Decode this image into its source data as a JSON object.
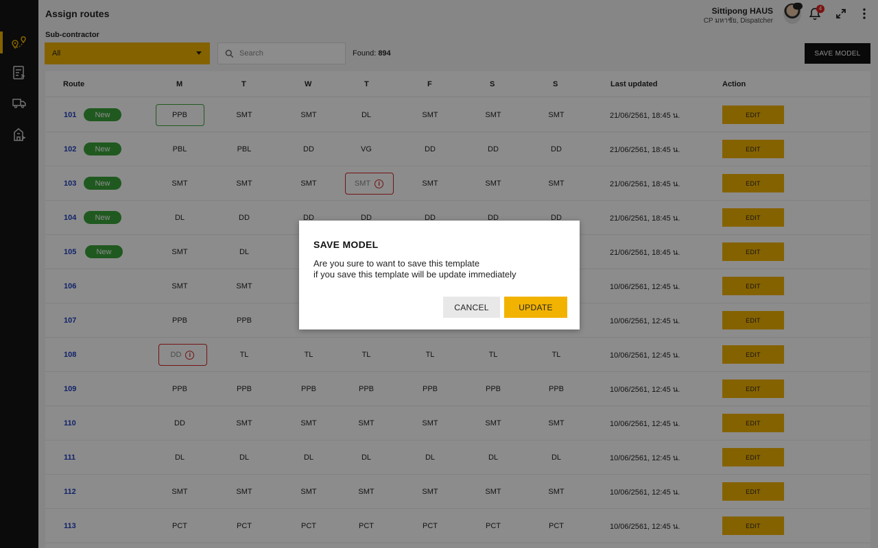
{
  "header": {
    "title": "Assign routes",
    "user_name": "Sittipong HAUS",
    "user_role": "CP มหาชัย, Dispatcher",
    "avatar_badge": "",
    "notification_count": "4"
  },
  "sidebar": {
    "items": [
      {
        "icon": "route-map-icon",
        "active": true
      },
      {
        "icon": "route-list-icon",
        "active": false
      },
      {
        "icon": "truck-icon",
        "active": false
      },
      {
        "icon": "warehouse-icon",
        "active": false
      }
    ]
  },
  "toolbar": {
    "subcontractor_label": "Sub-contractor",
    "subcontractor_value": "All",
    "search_placeholder": "Search",
    "found_label": "Found:",
    "found_count": "894",
    "save_model_label": "SAVE MODEL"
  },
  "table": {
    "headers": [
      "Route",
      "M",
      "T",
      "W",
      "T",
      "F",
      "S",
      "S",
      "Last updated",
      "Action"
    ],
    "edit_label": "EDIT",
    "new_label": "New",
    "rows": [
      {
        "route": "101",
        "new": true,
        "days": [
          "PPB",
          "SMT",
          "SMT",
          "DL",
          "SMT",
          "SMT",
          "SMT"
        ],
        "ok": 0,
        "err": -1,
        "updated": "21/06/2561, 18:45 น."
      },
      {
        "route": "102",
        "new": true,
        "days": [
          "PBL",
          "PBL",
          "DD",
          "VG",
          "DD",
          "DD",
          "DD"
        ],
        "ok": -1,
        "err": -1,
        "updated": "21/06/2561, 18:45 น."
      },
      {
        "route": "103",
        "new": true,
        "days": [
          "SMT",
          "SMT",
          "SMT",
          "SMT",
          "SMT",
          "SMT",
          "SMT"
        ],
        "ok": -1,
        "err": 3,
        "updated": "21/06/2561, 18:45 น."
      },
      {
        "route": "104",
        "new": true,
        "days": [
          "DL",
          "DD",
          "DD",
          "DD",
          "DD",
          "DD",
          "DD"
        ],
        "ok": -1,
        "err": -1,
        "updated": "21/06/2561, 18:45 น."
      },
      {
        "route": "105",
        "new": true,
        "days": [
          "SMT",
          "DL",
          "",
          "",
          "",
          "",
          ""
        ],
        "ok": -1,
        "err": -1,
        "updated": "21/06/2561, 18:45 น."
      },
      {
        "route": "106",
        "new": false,
        "days": [
          "SMT",
          "SMT",
          "",
          "",
          "",
          "",
          ""
        ],
        "ok": -1,
        "err": -1,
        "updated": "10/06/2561, 12:45 น."
      },
      {
        "route": "107",
        "new": false,
        "days": [
          "PPB",
          "PPB",
          "",
          "",
          "",
          "",
          ""
        ],
        "ok": -1,
        "err": -1,
        "updated": "10/06/2561, 12:45 น."
      },
      {
        "route": "108",
        "new": false,
        "days": [
          "DD",
          "TL",
          "TL",
          "TL",
          "TL",
          "TL",
          "TL"
        ],
        "ok": -1,
        "err": 0,
        "updated": "10/06/2561, 12:45 น."
      },
      {
        "route": "109",
        "new": false,
        "days": [
          "PPB",
          "PPB",
          "PPB",
          "PPB",
          "PPB",
          "PPB",
          "PPB"
        ],
        "ok": -1,
        "err": -1,
        "updated": "10/06/2561, 12:45 น."
      },
      {
        "route": "110",
        "new": false,
        "days": [
          "DD",
          "SMT",
          "SMT",
          "SMT",
          "SMT",
          "SMT",
          "SMT"
        ],
        "ok": -1,
        "err": -1,
        "updated": "10/06/2561, 12:45 น."
      },
      {
        "route": "111",
        "new": false,
        "days": [
          "DL",
          "DL",
          "DL",
          "DL",
          "DL",
          "DL",
          "DL"
        ],
        "ok": -1,
        "err": -1,
        "updated": "10/06/2561, 12:45 น."
      },
      {
        "route": "112",
        "new": false,
        "days": [
          "SMT",
          "SMT",
          "SMT",
          "SMT",
          "SMT",
          "SMT",
          "SMT"
        ],
        "ok": -1,
        "err": -1,
        "updated": "10/06/2561, 12:45 น."
      },
      {
        "route": "113",
        "new": false,
        "days": [
          "PCT",
          "PCT",
          "PCT",
          "PCT",
          "PCT",
          "PCT",
          "PCT"
        ],
        "ok": -1,
        "err": -1,
        "updated": "10/06/2561, 12:45 น."
      }
    ]
  },
  "modal": {
    "title": "SAVE MODEL",
    "line1": "Are you sure to want to save this template",
    "line2": "if you save this template will be update immediately",
    "cancel_label": "CANCEL",
    "update_label": "UPDATE"
  },
  "colors": {
    "accent": "#f2b300",
    "sidebar": "#141414",
    "new_badge": "#3aa33a",
    "error": "#d32020",
    "link": "#1f3fbf"
  }
}
